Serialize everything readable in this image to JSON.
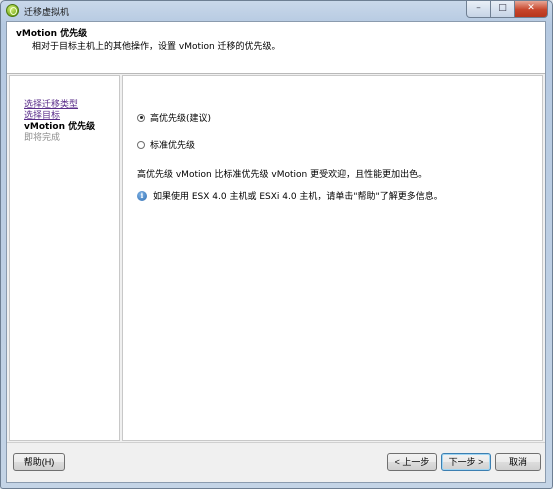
{
  "window": {
    "title": "迁移虚拟机",
    "minimize_label": "–",
    "maximize_label": "□",
    "close_label": "✕"
  },
  "header": {
    "title": "vMotion 优先级",
    "subtitle": "相对于目标主机上的其他操作，设置 vMotion 迁移的优先级。"
  },
  "steps": [
    {
      "label": "选择迁移类型",
      "state": "link"
    },
    {
      "label": "选择目标",
      "state": "link"
    },
    {
      "label": "vMotion 优先级",
      "state": "current"
    },
    {
      "label": "即将完成",
      "state": "future"
    }
  ],
  "content": {
    "options": [
      {
        "label": "高优先级(建议)",
        "selected": true
      },
      {
        "label": "标准优先级",
        "selected": false
      }
    ],
    "description": "高优先级 vMotion 比标准优先级 vMotion 更受欢迎，且性能更加出色。",
    "info_icon": "info-icon",
    "info_text": "如果使用 ESX 4.0 主机或 ESXi 4.0 主机，请单击\"帮助\"了解更多信息。"
  },
  "footer": {
    "help_label": "帮助(H)",
    "back_label": "< 上一步",
    "next_label": "下一步 >",
    "cancel_label": "取消"
  }
}
